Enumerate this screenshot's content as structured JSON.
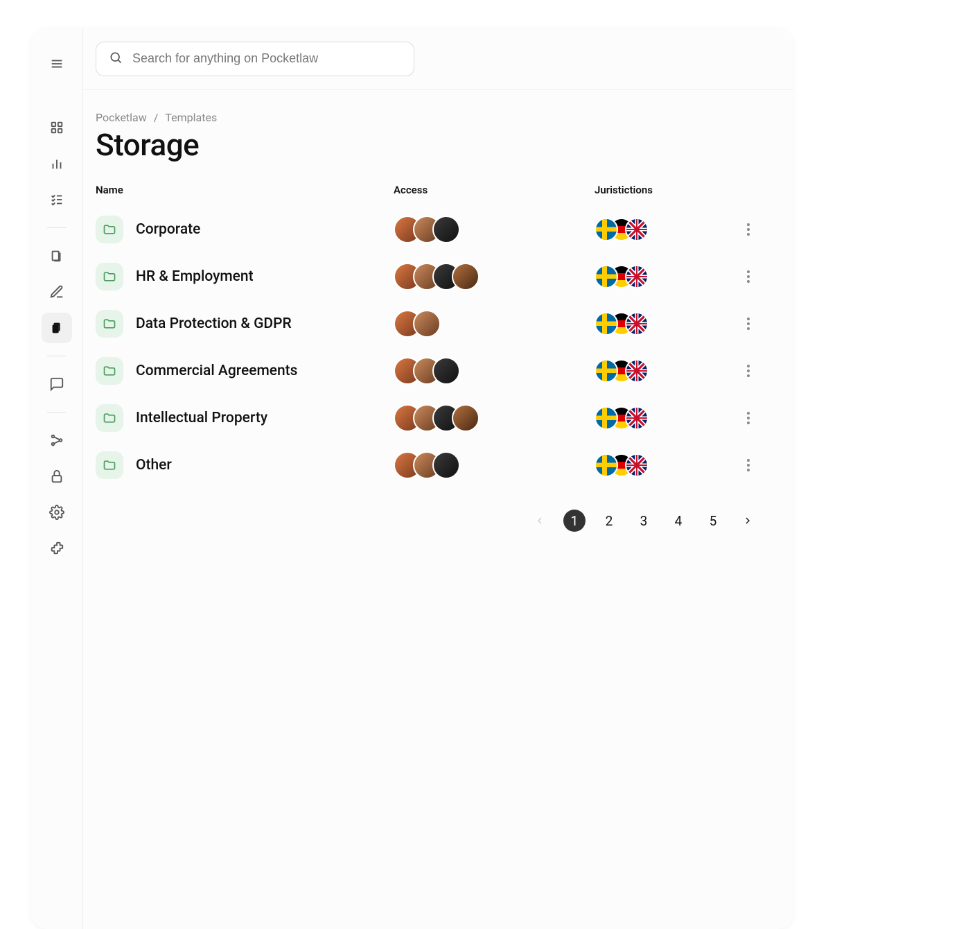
{
  "search": {
    "placeholder": "Search for anything on Pocketlaw"
  },
  "breadcrumbs": [
    {
      "label": "Pocketlaw"
    },
    {
      "label": "Templates"
    }
  ],
  "page_title": "Storage",
  "columns": {
    "name": "Name",
    "access": "Access",
    "jurisdictions": "Juristictions"
  },
  "folders": [
    {
      "name": "Corporate",
      "avatar_count": 3,
      "flags": [
        "se",
        "de",
        "uk"
      ]
    },
    {
      "name": "HR & Employment",
      "avatar_count": 4,
      "flags": [
        "se",
        "de",
        "uk"
      ]
    },
    {
      "name": "Data Protection & GDPR",
      "avatar_count": 2,
      "flags": [
        "se",
        "de",
        "uk"
      ]
    },
    {
      "name": "Commercial Agreements",
      "avatar_count": 3,
      "flags": [
        "se",
        "de",
        "uk"
      ]
    },
    {
      "name": "Intellectual Property",
      "avatar_count": 4,
      "flags": [
        "se",
        "de",
        "uk"
      ]
    },
    {
      "name": "Other",
      "avatar_count": 3,
      "flags": [
        "se",
        "de",
        "uk"
      ]
    }
  ],
  "pagination": {
    "pages": [
      "1",
      "2",
      "3",
      "4",
      "5"
    ],
    "current": 1
  }
}
